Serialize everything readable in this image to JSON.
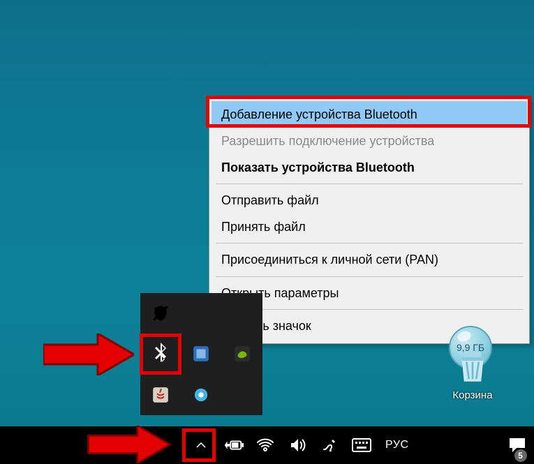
{
  "context_menu": {
    "items": [
      {
        "label": "Добавление устройства Bluetooth",
        "state": "highlighted"
      },
      {
        "label": "Разрешить подключение устройства",
        "state": "disabled"
      },
      {
        "label": "Показать устройства Bluetooth",
        "state": "bold"
      },
      {
        "sep": true
      },
      {
        "label": "Отправить файл"
      },
      {
        "label": "Принять файл"
      },
      {
        "sep": true
      },
      {
        "label": "Присоединиться к личной сети (PAN)"
      },
      {
        "sep": true
      },
      {
        "label": "Открыть параметры"
      },
      {
        "sep": true
      },
      {
        "label": "Удалить значок"
      }
    ]
  },
  "tray_flyout": {
    "icons": [
      "defender-off-icon",
      "",
      "",
      "bluetooth-icon",
      "intel-icon",
      "nvidia-icon",
      "java-icon",
      "record-icon",
      ""
    ]
  },
  "taskbar": {
    "lang": "РУС",
    "action_center_count": "5"
  },
  "recycle_bin": {
    "label": "Корзина",
    "size": "9,9 ГБ"
  }
}
